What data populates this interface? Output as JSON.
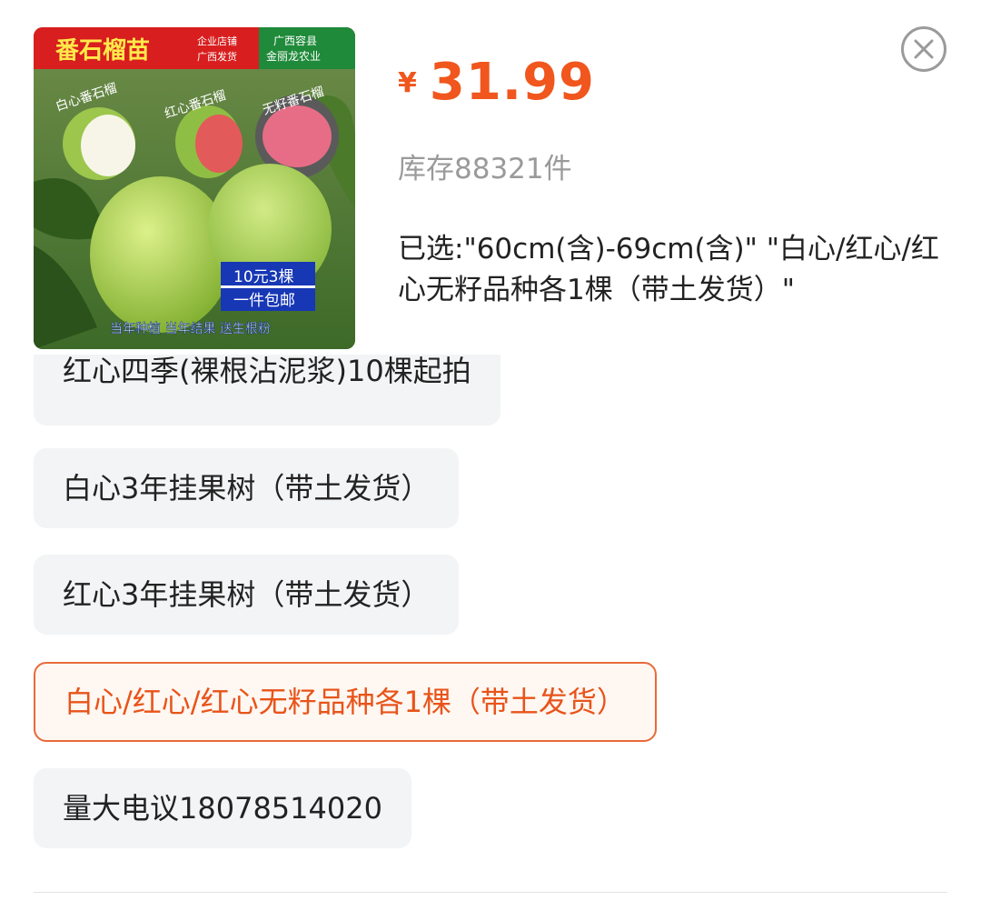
{
  "product": {
    "image_alt": "番石榴苗 product image",
    "image_banner_title": "番石榴苗",
    "image_banner_shop": "企业店铺",
    "image_banner_ship": "广西发货",
    "image_banner_region": "广西容县",
    "image_banner_farm": "金丽龙农业",
    "image_tag_white": "白心番石榴",
    "image_tag_red": "红心番石榴",
    "image_tag_seedless": "无籽番石榴",
    "image_promo_1": "10元3棵",
    "image_promo_2": "一件包邮",
    "image_footer": "当年种植 当年结果 送生根粉",
    "price_symbol": "¥",
    "price": "31.99",
    "stock": "库存88321件",
    "selected_text": "已选:\"60cm(含)-69cm(含)\" \"白心/红心/红心无籽品种各1棵（带土发货）\""
  },
  "close_icon": "close-icon",
  "options": [
    {
      "label": "红心四季(裸根沾泥浆)10棵起拍",
      "state": "clipped"
    },
    {
      "label": "白心3年挂果树（带土发货）",
      "state": "normal"
    },
    {
      "label": "红心3年挂果树（带土发货）",
      "state": "normal"
    },
    {
      "label": "白心/红心/红心无籽品种各1棵（带土发货）",
      "state": "selected"
    },
    {
      "label": "量大电议18078514020",
      "state": "normal"
    }
  ],
  "colors": {
    "accent": "#f0561d",
    "option_bg": "#f3f4f5",
    "selected_border": "#e86a3a",
    "muted_text": "#9a9a9a"
  }
}
